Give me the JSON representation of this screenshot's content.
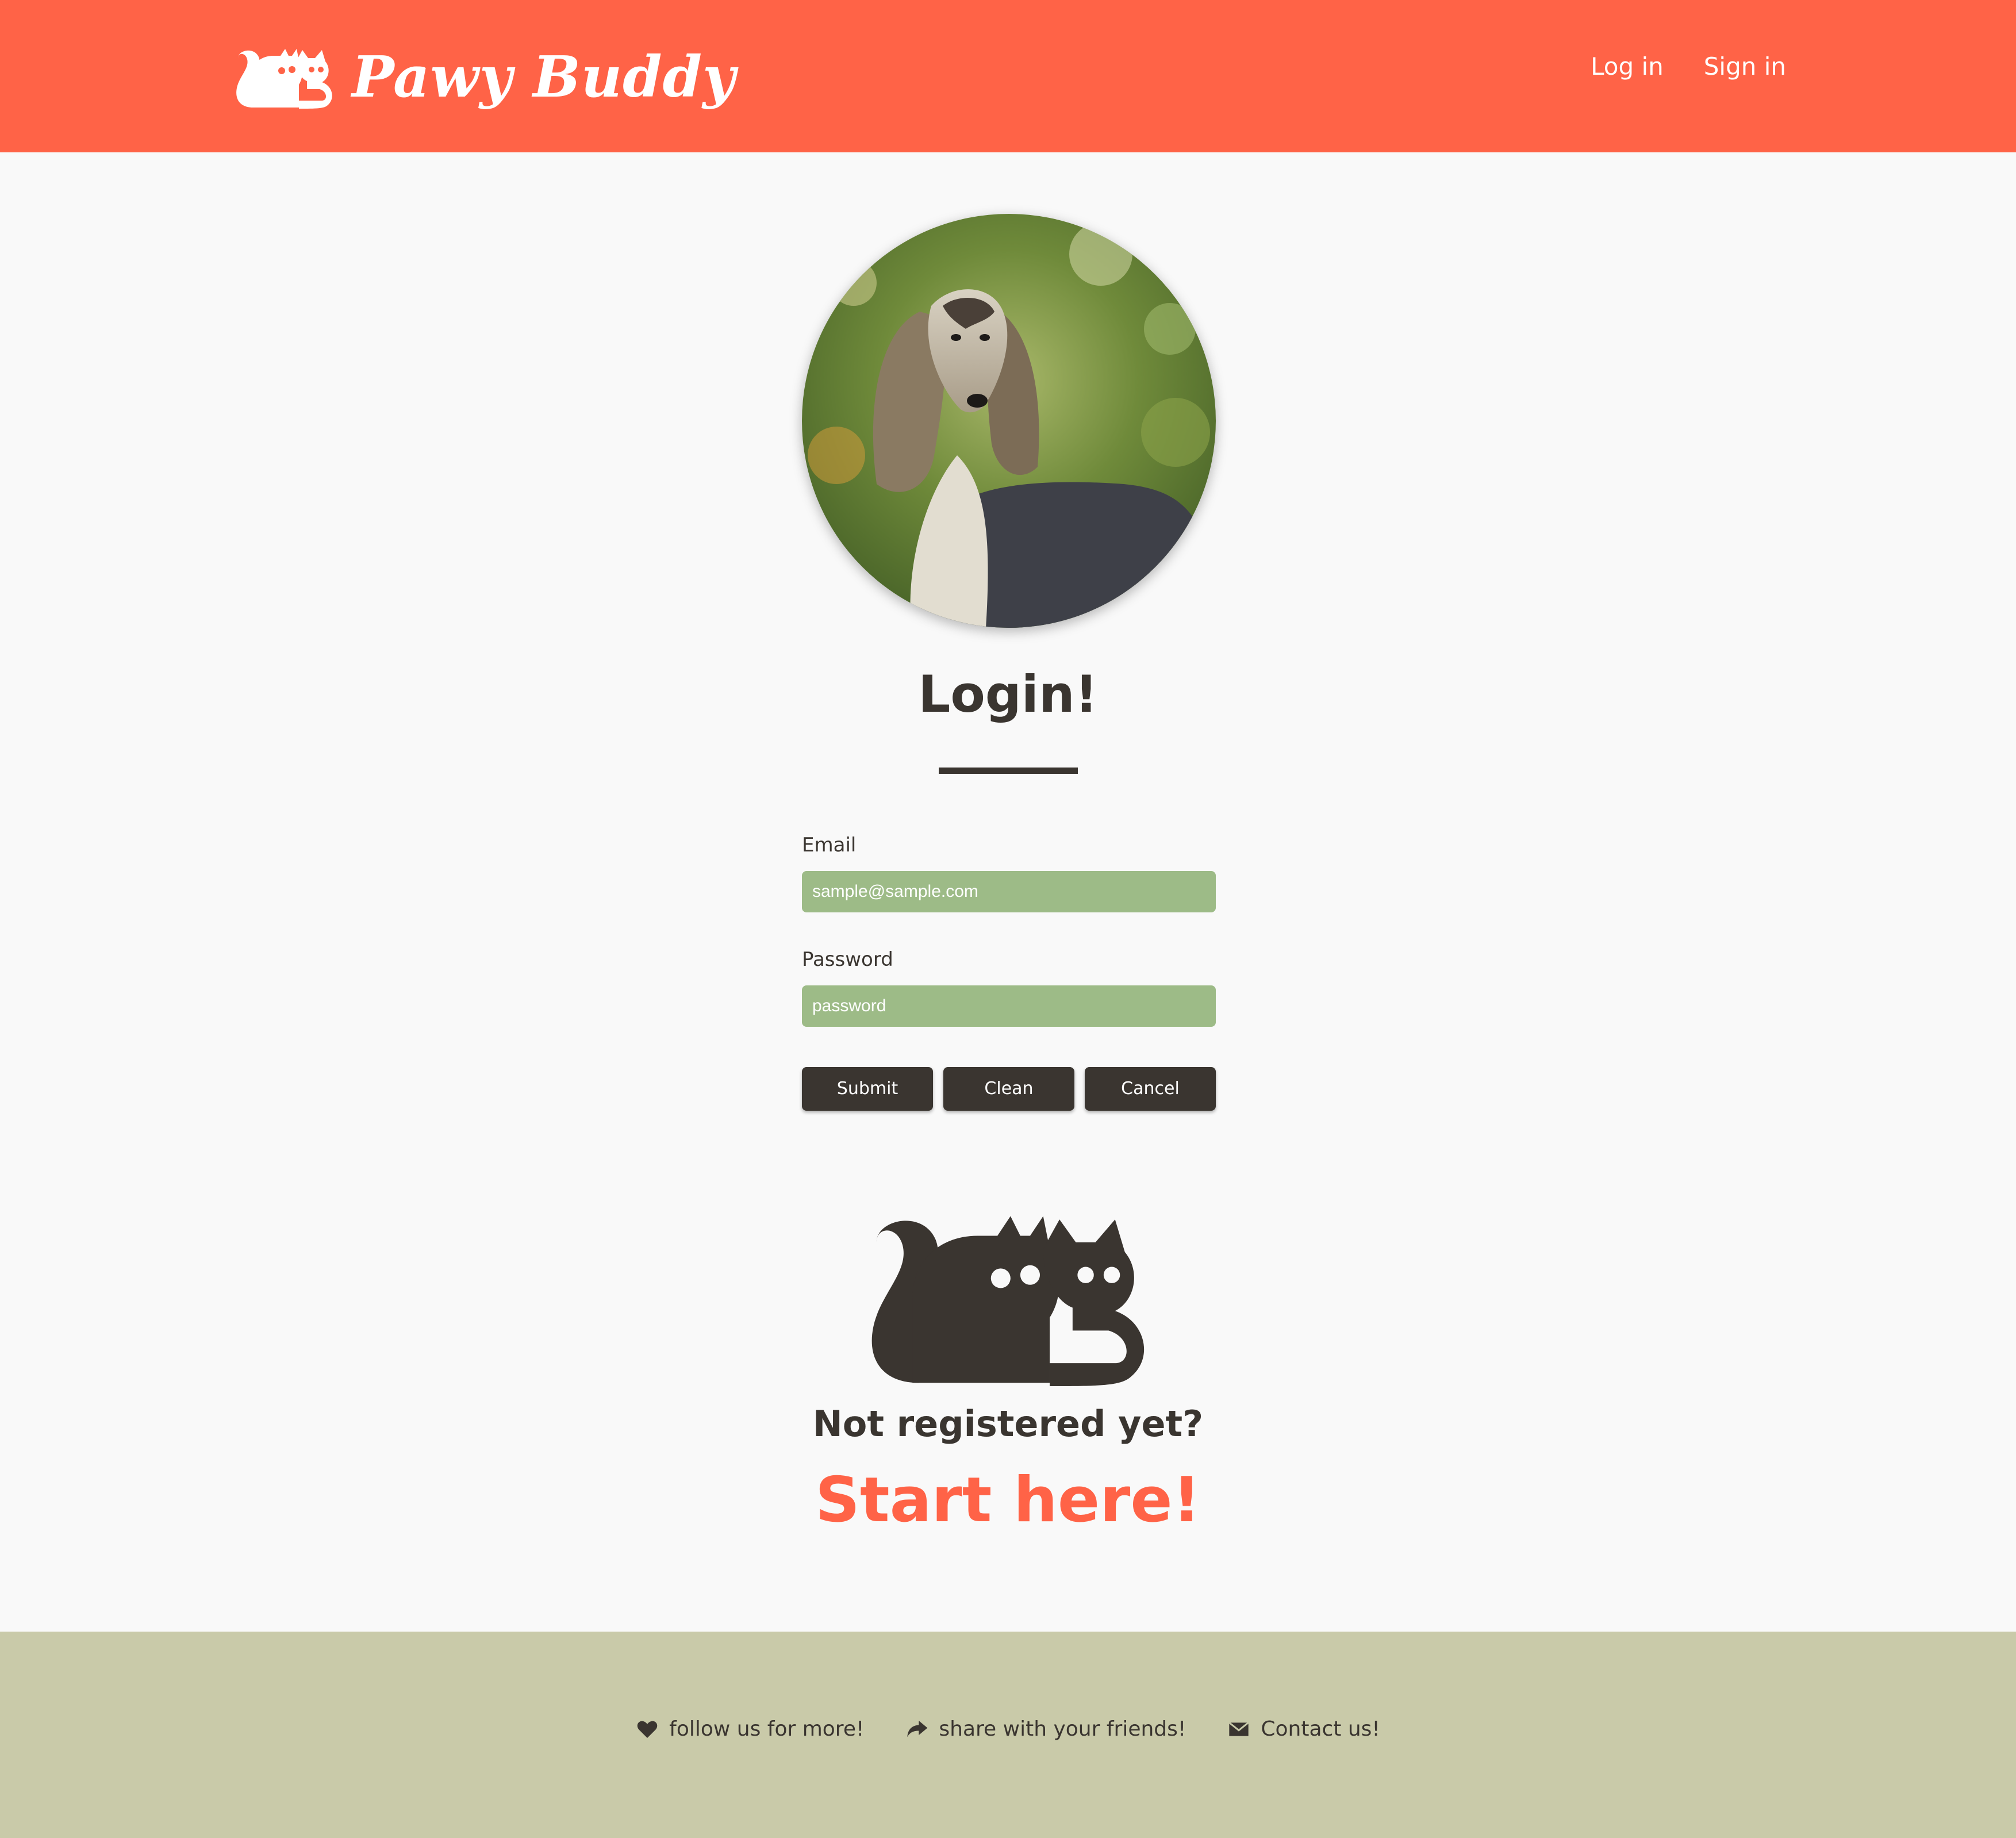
{
  "header": {
    "brand_name": "Pawy Buddy",
    "nav": [
      {
        "label": "Log in"
      },
      {
        "label": "Sign in"
      }
    ]
  },
  "main": {
    "avatar_image": "dog-photo",
    "title": "Login!",
    "form": {
      "email_label": "Email",
      "email_placeholder": "sample@sample.com",
      "email_value": "",
      "password_label": "Password",
      "password_placeholder": "password",
      "password_value": ""
    },
    "buttons": {
      "submit": "Submit",
      "clean": "Clean",
      "cancel": "Cancel"
    },
    "register": {
      "prompt": "Not registered yet?",
      "cta": "Start here!"
    }
  },
  "footer": {
    "links": [
      {
        "label": "follow us for more!",
        "icon": "heart-icon"
      },
      {
        "label": "share with your friends!",
        "icon": "share-icon"
      },
      {
        "label": "Contact us!",
        "icon": "envelope-icon"
      }
    ]
  },
  "colors": {
    "accent": "#ff6347",
    "dark": "#3a3530",
    "input_bg": "#9dbb87",
    "footer_bg": "#c9caa9",
    "page_bg": "#f9f9f9"
  }
}
